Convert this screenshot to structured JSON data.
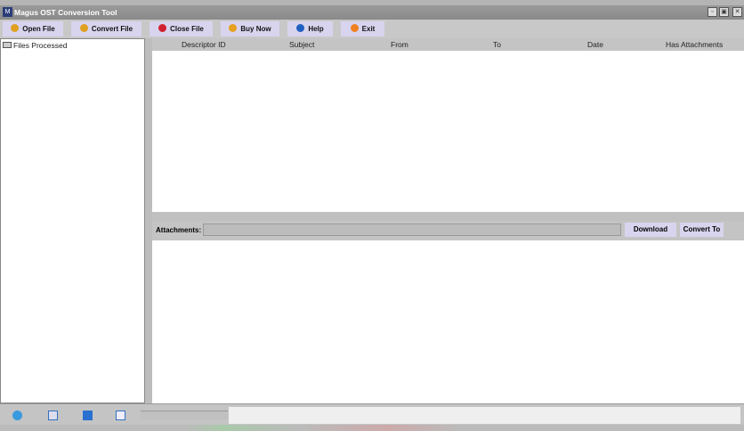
{
  "window": {
    "title": "Magus OST Conversion Tool"
  },
  "toolbar": {
    "open": "Open File",
    "convert": "Convert File",
    "close": "Close File",
    "buy": "Buy Now",
    "help": "Help",
    "exit": "Exit"
  },
  "tree": {
    "root": "Files Processed"
  },
  "table": {
    "columns": [
      "Descriptor ID",
      "Subject",
      "From",
      "To",
      "Date",
      "Has Attachments"
    ]
  },
  "attachments": {
    "label": "Attachments:",
    "value": "",
    "download": "Download",
    "convert_to": "Convert To"
  }
}
